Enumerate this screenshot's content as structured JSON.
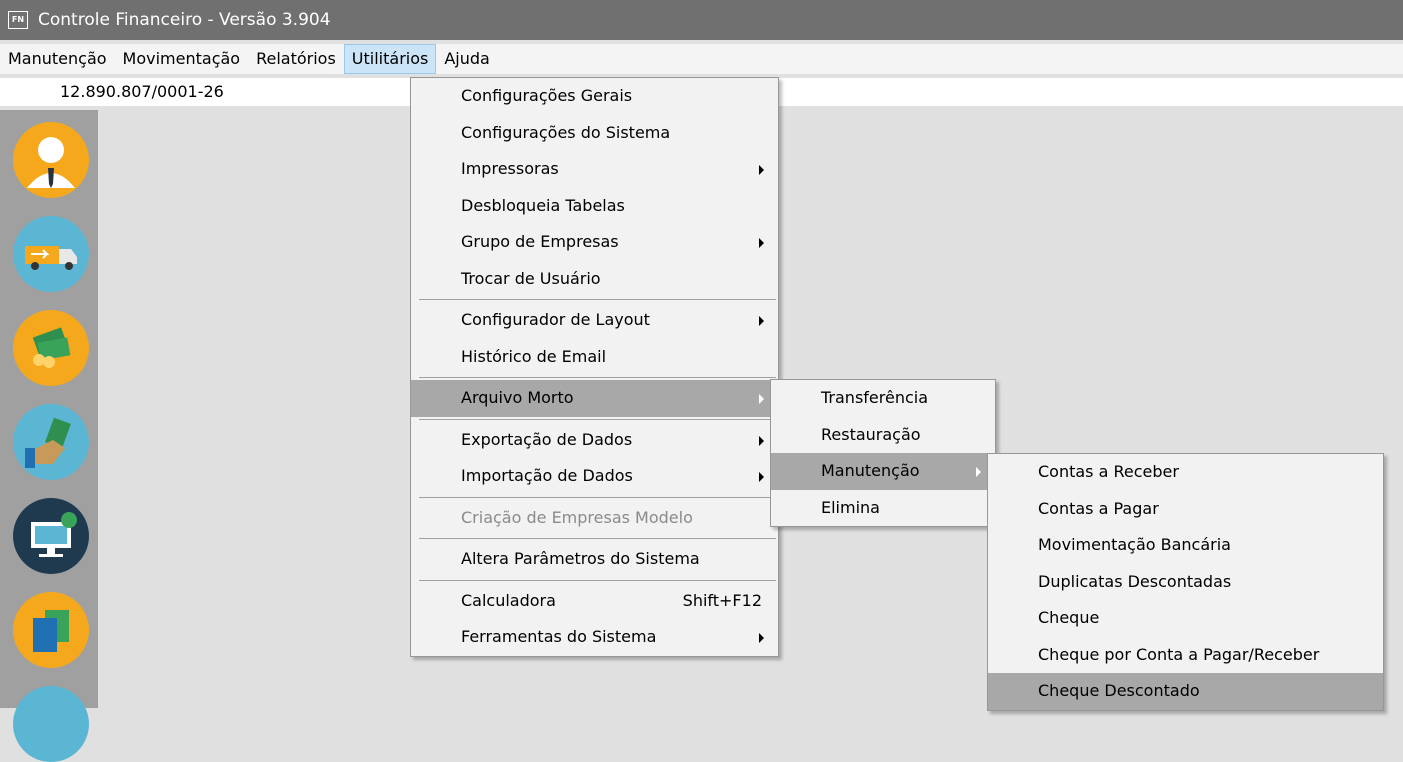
{
  "window": {
    "icon_text": "FN",
    "title": "Controle Financeiro - Versão 3.904"
  },
  "menubar": {
    "items": [
      "Manutenção",
      "Movimentação",
      "Relatórios",
      "Utilitários",
      "Ajuda"
    ],
    "active": "Utilitários"
  },
  "company": {
    "cnpj": "12.890.807/0001-26"
  },
  "sidebar": {
    "icons": [
      "user-icon",
      "truck-icon",
      "money-icon",
      "payment-hand-icon",
      "computer-icon",
      "documents-icon"
    ]
  },
  "utilitarios_menu": {
    "items": [
      {
        "label": "Configurações Gerais"
      },
      {
        "label": "Configurações do Sistema"
      },
      {
        "label": "Impressoras"
      },
      {
        "label": "Desbloqueia Tabelas"
      },
      {
        "label": "Grupo de Empresas"
      },
      {
        "label": "Trocar de Usuário"
      },
      {
        "label": "Configurador de Layout"
      },
      {
        "label": "Histórico de Email"
      },
      {
        "label": "Arquivo Morto"
      },
      {
        "label": "Exportação de Dados"
      },
      {
        "label": "Importação de Dados"
      },
      {
        "label": "Criação de Empresas Modelo"
      },
      {
        "label": "Altera Parâmetros do Sistema"
      },
      {
        "label": "Calculadora",
        "shortcut": "Shift+F12"
      },
      {
        "label": "Ferramentas do Sistema"
      }
    ]
  },
  "arquivo_morto_menu": {
    "items": [
      {
        "label": "Transferência"
      },
      {
        "label": "Restauração"
      },
      {
        "label": "Manutenção"
      },
      {
        "label": "Elimina"
      }
    ]
  },
  "manutencao_menu": {
    "items": [
      {
        "label": "Contas a Receber"
      },
      {
        "label": "Contas a Pagar"
      },
      {
        "label": "Movimentação Bancária"
      },
      {
        "label": "Duplicatas Descontadas"
      },
      {
        "label": "Cheque"
      },
      {
        "label": "Cheque por Conta a Pagar/Receber"
      },
      {
        "label": "Cheque Descontado"
      }
    ]
  },
  "colors": {
    "titlebar": "#707070",
    "highlight": "#a8a8a8",
    "menubar_active": "#cce4f7",
    "sidebar": "#a0a0a0"
  }
}
